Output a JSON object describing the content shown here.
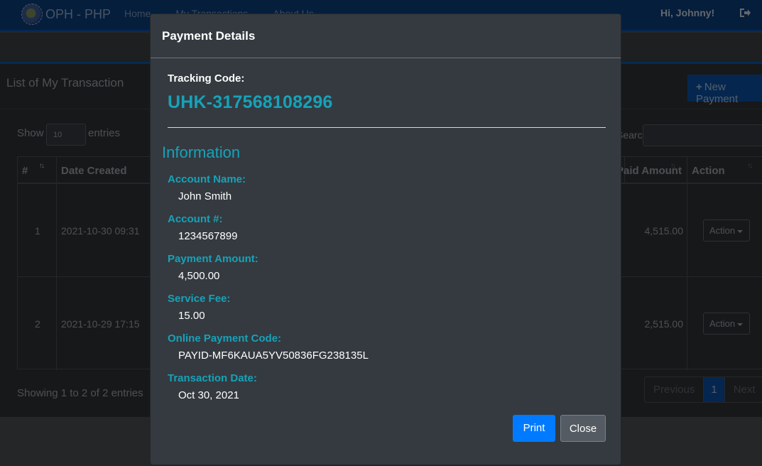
{
  "navbar": {
    "brand": "OPH - PHP",
    "links": [
      "Home",
      "My Transactions",
      "About Us"
    ],
    "greeting": "Hi, Johnny!",
    "logout_icon": "sign-out-icon"
  },
  "page": {
    "card_title": "List of My Transaction",
    "new_button": "New Payment",
    "show_label": "Show",
    "entries_value": "10",
    "entries_label": "entries",
    "search_label": "Search:",
    "search_value": "",
    "columns": [
      "#",
      "Date Created",
      "Paid Amount",
      "Action"
    ],
    "rows": [
      {
        "num": "1",
        "date": "2021-10-30 09:31",
        "amount": "4,515.00",
        "action": "Action"
      },
      {
        "num": "2",
        "date": "2021-10-29 17:15",
        "amount": "2,515.00",
        "action": "Action"
      }
    ],
    "info": "Showing 1 to 2 of 2 entries",
    "pagination": {
      "previous": "Previous",
      "current": "1",
      "next": "Next"
    }
  },
  "modal": {
    "title": "Payment Details",
    "tracking_label": "Tracking Code:",
    "tracking_code": "UHK-317568108296",
    "section_heading": "Information",
    "fields": [
      {
        "label": "Account Name:",
        "value": "John Smith"
      },
      {
        "label": "Account #:",
        "value": "1234567899"
      },
      {
        "label": "Payment Amount:",
        "value": "4,500.00"
      },
      {
        "label": "Service Fee:",
        "value": "15.00"
      },
      {
        "label": "Online Payment Code:",
        "value": "PAYID-MF6KAUA5YV50836FG238135L"
      },
      {
        "label": "Transaction Date:",
        "value": "Oct 30, 2021"
      }
    ],
    "print_button": "Print",
    "close_button": "Close"
  },
  "colors": {
    "accent_teal": "#17a2b8",
    "primary_blue": "#007bff",
    "navbar_blue": "#0b3d78"
  }
}
